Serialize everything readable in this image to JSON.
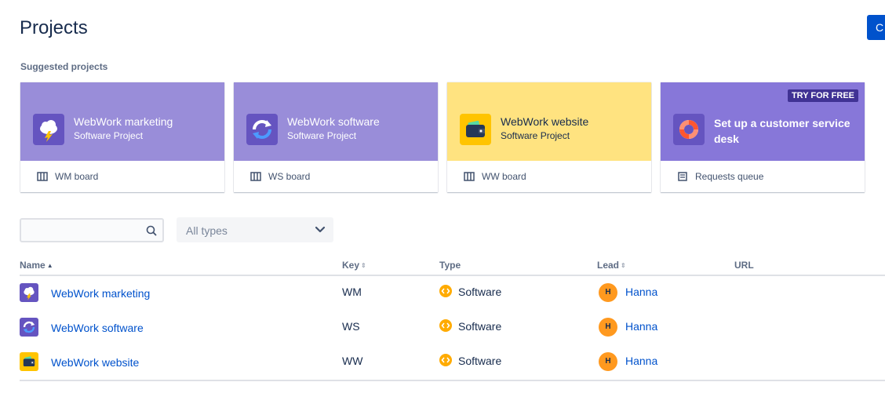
{
  "header": {
    "title": "Projects",
    "create_button_label": "C"
  },
  "suggested": {
    "label": "Suggested projects",
    "cards": [
      {
        "title": "WebWork marketing",
        "subtitle": "Software Project",
        "link": "WM board",
        "color": "#998dd9",
        "icon": "cloud-lightning-icon"
      },
      {
        "title": "WebWork software",
        "subtitle": "Software Project",
        "link": "WS board",
        "color": "#998dd9",
        "icon": "refresh-icon"
      },
      {
        "title": "WebWork website",
        "subtitle": "Software Project",
        "link": "WW board",
        "color": "#ffe380",
        "icon": "wallet-icon"
      },
      {
        "title": "Set up a customer service desk",
        "badge": "TRY FOR FREE",
        "link": "Requests queue",
        "color": "#8777d9",
        "icon": "lifebuoy-icon"
      }
    ]
  },
  "filters": {
    "search_placeholder": "",
    "type_select_value": "All types"
  },
  "table": {
    "headers": {
      "name": "Name",
      "key": "Key",
      "type": "Type",
      "lead": "Lead",
      "url": "URL"
    },
    "rows": [
      {
        "name": "WebWork marketing",
        "key": "WM",
        "type": "Software",
        "lead": "Hanna",
        "lead_initial": "H",
        "icon": "cloud-lightning-icon"
      },
      {
        "name": "WebWork software",
        "key": "WS",
        "type": "Software",
        "lead": "Hanna",
        "lead_initial": "H",
        "icon": "refresh-icon"
      },
      {
        "name": "WebWork website",
        "key": "WW",
        "type": "Software",
        "lead": "Hanna",
        "lead_initial": "H",
        "icon": "wallet-icon"
      }
    ]
  }
}
